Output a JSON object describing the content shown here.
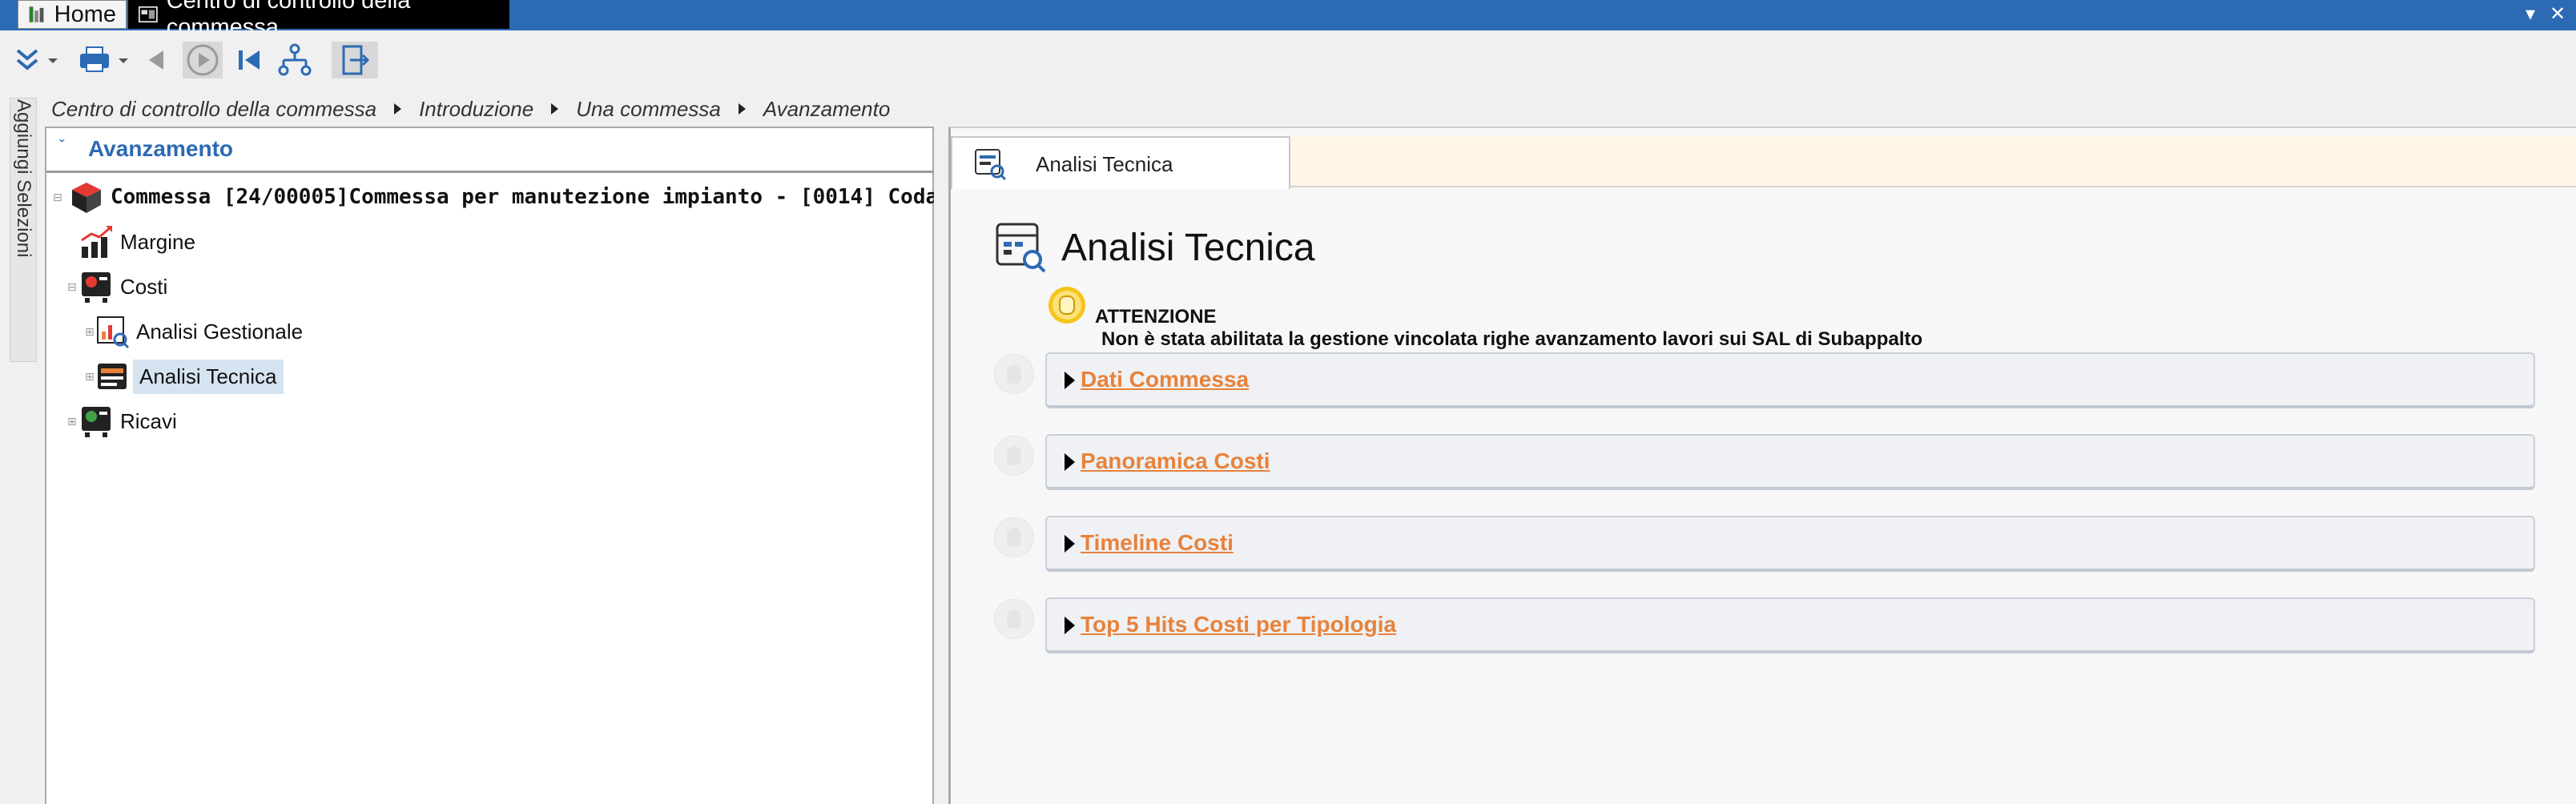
{
  "window": {
    "tabs": [
      {
        "label": "Home",
        "icon": "app-logo-icon"
      },
      {
        "label": "Centro di controllo della commessa",
        "icon": "dashboard-icon"
      }
    ],
    "controls": {
      "minimize": "▾",
      "close": "✕"
    }
  },
  "toolbar": {
    "buttons": [
      "collapse-expand-icon",
      "print-icon",
      "back-icon",
      "play-icon",
      "first-icon",
      "hierarchy-icon",
      "exit-icon"
    ]
  },
  "breadcrumb": {
    "items": [
      "Centro di controllo della commessa",
      "Introduzione",
      "Una commessa",
      "Avanzamento"
    ]
  },
  "rail": {
    "label": "Aggiungi Selezioni"
  },
  "left_panel": {
    "title": "Avanzamento",
    "tree": [
      {
        "label": "Commessa [24/00005]Commessa per manutezione impianto - [0014] Coda",
        "icon": "cube-icon",
        "level": 0
      },
      {
        "label": "Margine",
        "icon": "chart-growth-icon",
        "level": 1
      },
      {
        "label": "Costi",
        "icon": "cost-register-icon",
        "level": 1
      },
      {
        "label": "Analisi Gestionale",
        "icon": "analysis-chart-icon",
        "level": 2
      },
      {
        "label": "Analisi Tecnica",
        "icon": "technical-analysis-icon",
        "level": 2,
        "selected": true
      },
      {
        "label": "Ricavi",
        "icon": "revenue-register-icon",
        "level": 1
      }
    ]
  },
  "right_panel": {
    "tab_label": "Analisi Tecnica",
    "title": "Analisi Tecnica",
    "warning": {
      "title": "ATTENZIONE",
      "message": "Non è stata abilitata la gestione vincolata righe avanzamento lavori sui SAL di Subappalto"
    },
    "sections": [
      {
        "label": "Dati Commessa"
      },
      {
        "label": "Panoramica Costi"
      },
      {
        "label": "Timeline Costi"
      },
      {
        "label": "Top 5 Hits Costi per Tipologia"
      }
    ]
  },
  "colors": {
    "title_bar": "#2d6ab4",
    "accent": "#2d6ab4",
    "section_link": "#e8823a",
    "selection": "#d6e4f2",
    "tab_strip": "#fff6e8"
  }
}
